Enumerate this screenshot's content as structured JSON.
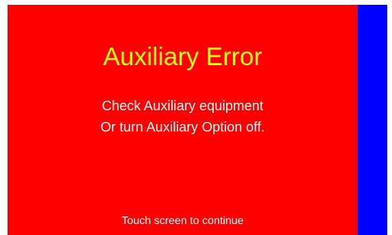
{
  "colors": {
    "background": "#ff0000",
    "side_panel": "#0000ff",
    "title": "#ffff00",
    "text": "#ffffff"
  },
  "error": {
    "title": "Auxiliary Error",
    "message_line_1": "Check Auxiliary equipment",
    "message_line_2": "Or turn Auxiliary Option off.",
    "prompt": "Touch screen to continue"
  }
}
